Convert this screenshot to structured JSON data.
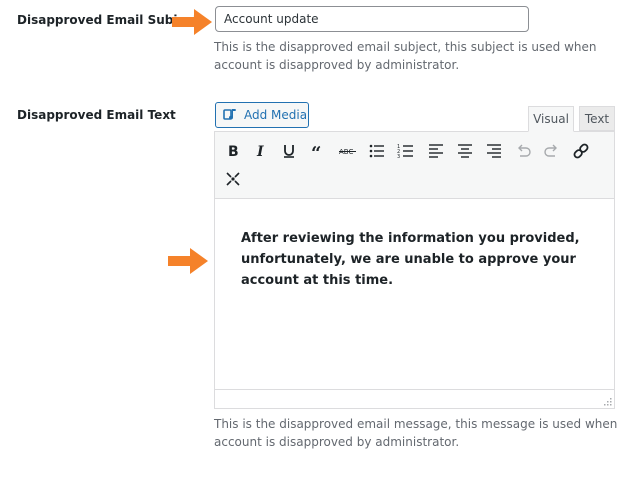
{
  "fields": {
    "subject": {
      "label": "Disapproved Email Subject",
      "value": "Account update",
      "description": "This is the disapproved email subject, this subject is used when account is disapproved by administrator."
    },
    "text": {
      "label": "Disapproved Email Text",
      "description": "This is the disapproved email message, this message is used when account is disapproved by administrator."
    }
  },
  "editor": {
    "add_media_label": "Add Media",
    "tabs": {
      "visual": "Visual",
      "text": "Text"
    },
    "active_tab": "Visual",
    "content": "After reviewing the information you provided, unfortunately, we are unable to approve your account at this time.",
    "toolbar_icons": [
      "bold-icon",
      "italic-icon",
      "underline-icon",
      "blockquote-icon",
      "strikethrough-icon",
      "bulleted-list-icon",
      "numbered-list-icon",
      "align-left-icon",
      "align-center-icon",
      "align-right-icon",
      "undo-icon",
      "redo-icon",
      "insert-link-icon",
      "fullscreen-icon"
    ]
  },
  "colors": {
    "arrow": "#f5822a",
    "accent": "#2271b1",
    "description_text": "#646970"
  }
}
